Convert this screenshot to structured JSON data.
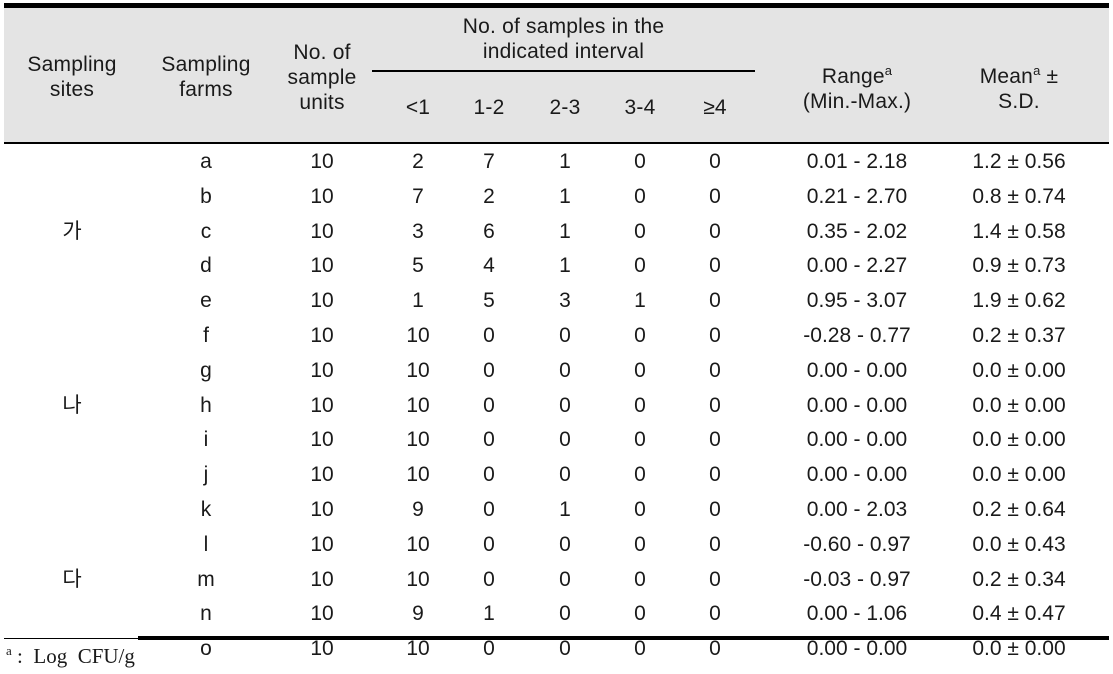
{
  "table": {
    "headers": {
      "sampling_sites": "Sampling\nsites",
      "sampling_sites_line1": "Sampling",
      "sampling_sites_line2": "sites",
      "sampling_farms_line1": "Sampling",
      "sampling_farms_line2": "farms",
      "sample_units_line1": "No. of",
      "sample_units_line2": "sample",
      "sample_units_line3": "units",
      "interval_group_line1": "No. of samples in the",
      "interval_group_line2": "indicated interval",
      "interval_cols": [
        "<1",
        "1-2",
        "2-3",
        "3-4",
        "≥4"
      ],
      "range_line1": "Range",
      "range_sup": "a",
      "range_line2": "(Min.-Max.)",
      "mean_line1": "Mean",
      "mean_sup": "a",
      "mean_pm": " ±",
      "mean_line2": "S.D."
    },
    "site_groups": [
      {
        "label": "가",
        "row_index": 2
      },
      {
        "label": "나",
        "row_index": 7
      },
      {
        "label": "다",
        "row_index": 12
      }
    ],
    "rows": [
      {
        "farm": "a",
        "units": "10",
        "i1": "2",
        "i2": "7",
        "i3": "1",
        "i4": "0",
        "i5": "0",
        "range": "0.01 -  2.18",
        "mean": "1.2 ± 0.56"
      },
      {
        "farm": "b",
        "units": "10",
        "i1": "7",
        "i2": "2",
        "i3": "1",
        "i4": "0",
        "i5": "0",
        "range": "0.21 -  2.70",
        "mean": "0.8 ± 0.74"
      },
      {
        "farm": "c",
        "units": "10",
        "i1": "3",
        "i2": "6",
        "i3": "1",
        "i4": "0",
        "i5": "0",
        "range": "0.35 -  2.02",
        "mean": "1.4 ± 0.58"
      },
      {
        "farm": "d",
        "units": "10",
        "i1": "5",
        "i2": "4",
        "i3": "1",
        "i4": "0",
        "i5": "0",
        "range": "0.00 -  2.27",
        "mean": "0.9 ± 0.73"
      },
      {
        "farm": "e",
        "units": "10",
        "i1": "1",
        "i2": "5",
        "i3": "3",
        "i4": "1",
        "i5": "0",
        "range": "0.95 -  3.07",
        "mean": "1.9 ± 0.62"
      },
      {
        "farm": "f",
        "units": "10",
        "i1": "10",
        "i2": "0",
        "i3": "0",
        "i4": "0",
        "i5": "0",
        "range": "-0.28 -  0.77",
        "mean": "0.2 ± 0.37"
      },
      {
        "farm": "g",
        "units": "10",
        "i1": "10",
        "i2": "0",
        "i3": "0",
        "i4": "0",
        "i5": "0",
        "range": "0.00 -  0.00",
        "mean": "0.0 ± 0.00"
      },
      {
        "farm": "h",
        "units": "10",
        "i1": "10",
        "i2": "0",
        "i3": "0",
        "i4": "0",
        "i5": "0",
        "range": "0.00 -  0.00",
        "mean": "0.0 ± 0.00"
      },
      {
        "farm": "i",
        "units": "10",
        "i1": "10",
        "i2": "0",
        "i3": "0",
        "i4": "0",
        "i5": "0",
        "range": "0.00 -  0.00",
        "mean": "0.0 ± 0.00"
      },
      {
        "farm": "j",
        "units": "10",
        "i1": "10",
        "i2": "0",
        "i3": "0",
        "i4": "0",
        "i5": "0",
        "range": "0.00 -  0.00",
        "mean": "0.0 ± 0.00"
      },
      {
        "farm": "k",
        "units": "10",
        "i1": "9",
        "i2": "0",
        "i3": "1",
        "i4": "0",
        "i5": "0",
        "range": "0.00 -  2.03",
        "mean": "0.2 ± 0.64"
      },
      {
        "farm": "l",
        "units": "10",
        "i1": "10",
        "i2": "0",
        "i3": "0",
        "i4": "0",
        "i5": "0",
        "range": "-0.60 -  0.97",
        "mean": "0.0 ± 0.43"
      },
      {
        "farm": "m",
        "units": "10",
        "i1": "10",
        "i2": "0",
        "i3": "0",
        "i4": "0",
        "i5": "0",
        "range": "-0.03 -  0.97",
        "mean": "0.2 ± 0.34"
      },
      {
        "farm": "n",
        "units": "10",
        "i1": "9",
        "i2": "1",
        "i3": "0",
        "i4": "0",
        "i5": "0",
        "range": "0.00 -  1.06",
        "mean": "0.4 ± 0.47"
      },
      {
        "farm": "o",
        "units": "10",
        "i1": "10",
        "i2": "0",
        "i3": "0",
        "i4": "0",
        "i5": "0",
        "range": "0.00 -  0.00",
        "mean": "0.0 ± 0.00"
      }
    ],
    "footnote": {
      "sup": "a",
      "text": " :  Log  CFU/g"
    }
  },
  "style": {
    "header_bg": "#e4e4e4",
    "text_color": "#1a1a1a",
    "rule_color": "#000000",
    "page_bg": "#ffffff"
  }
}
